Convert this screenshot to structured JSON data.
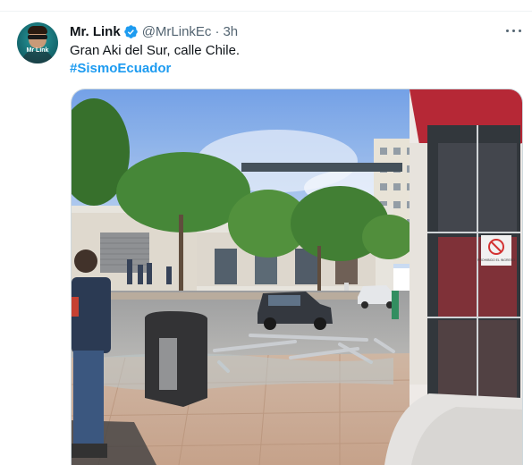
{
  "tweet": {
    "author_name": "Mr. Link",
    "handle": "@MrLinkEc",
    "separator": "·",
    "time": "3h",
    "text": "Gran Aki del Sur, calle Chile.",
    "hashtag": "#SismoEcuador",
    "avatar_text": "Mr Link"
  },
  "colors": {
    "link": "#1d9bf0",
    "verified": "#1d9bf0",
    "secondary_text": "#536471",
    "primary_text": "#0f1419"
  },
  "icons": {
    "verified": "verified-badge-icon",
    "more": "more-horizontal-icon"
  },
  "photo": {
    "sign_text": "PROHIBIDO EL INGRESO"
  }
}
